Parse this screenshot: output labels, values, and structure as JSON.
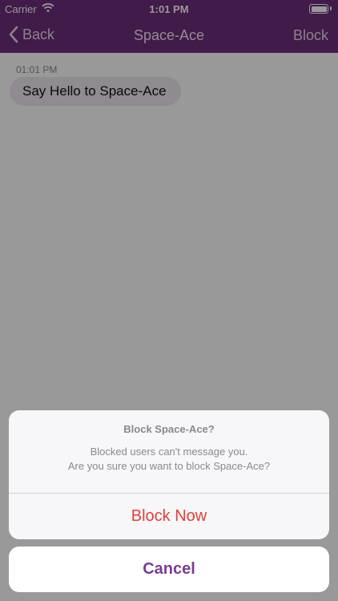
{
  "status_bar": {
    "carrier": "Carrier",
    "time": "1:01 PM"
  },
  "nav": {
    "back_label": "Back",
    "title": "Space-Ace",
    "block_label": "Block"
  },
  "chat": {
    "timestamp": "01:01 PM",
    "message": "Say Hello to Space-Ace"
  },
  "action_sheet": {
    "title": "Block Space-Ace?",
    "message_line1": "Blocked users can't message you.",
    "message_line2": "Are you sure you want to block Space-Ace?",
    "confirm_label": "Block Now",
    "cancel_label": "Cancel"
  },
  "colors": {
    "header_purple": "#6d2d7a",
    "destructive_red": "#e2403a",
    "cancel_purple": "#7a3d92"
  }
}
